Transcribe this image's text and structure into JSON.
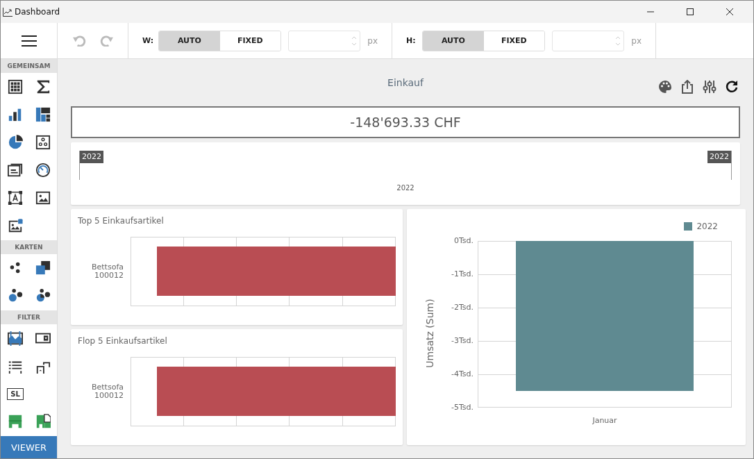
{
  "window": {
    "title": "Dashboard"
  },
  "toolbar": {
    "size_groups": [
      {
        "label": "W:",
        "options": [
          {
            "label": "AUTO",
            "selected": true
          },
          {
            "label": "FIXED",
            "selected": false
          }
        ],
        "unit": "px"
      },
      {
        "label": "H:",
        "options": [
          {
            "label": "AUTO",
            "selected": true
          },
          {
            "label": "FIXED",
            "selected": false
          }
        ],
        "unit": "px"
      }
    ]
  },
  "sidebar": {
    "sections": [
      {
        "title": "GEMEINSAM"
      },
      {
        "title": "KARTEN"
      },
      {
        "title": "FILTER",
        "badge_label": "SL"
      }
    ],
    "viewer_button": "VIEWER"
  },
  "dashboard": {
    "title": "Einkauf",
    "kpi": {
      "value": "-148'693.33 CHF"
    },
    "range_filter": {
      "start_label": "2022",
      "end_label": "2022",
      "axis_label": "2022"
    },
    "bar_panels": [
      {
        "title": "Top 5 Einkaufsartikel",
        "category": [
          "Bettsofa",
          "100012"
        ]
      },
      {
        "title": "Flop 5 Einkaufsartikel",
        "category": [
          "Bettsofa",
          "100012"
        ]
      }
    ],
    "column_chart": {
      "chart_data": {
        "type": "bar",
        "categories": [
          "Januar"
        ],
        "ylabel": "Umsatz (Sum)",
        "grid": true,
        "ylim": [
          -5,
          0
        ],
        "yticks": [
          {
            "value": 0,
            "label": "0Tsd."
          },
          {
            "value": -1,
            "label": "-1Tsd."
          },
          {
            "value": -2,
            "label": "-2Tsd."
          },
          {
            "value": -3,
            "label": "-3Tsd."
          },
          {
            "value": -4,
            "label": "-4Tsd."
          },
          {
            "value": -5,
            "label": "-5Tsd."
          }
        ],
        "series": [
          {
            "name": "2022",
            "color": "#5f8a91",
            "values": [
              -4.5
            ]
          }
        ]
      }
    }
  }
}
